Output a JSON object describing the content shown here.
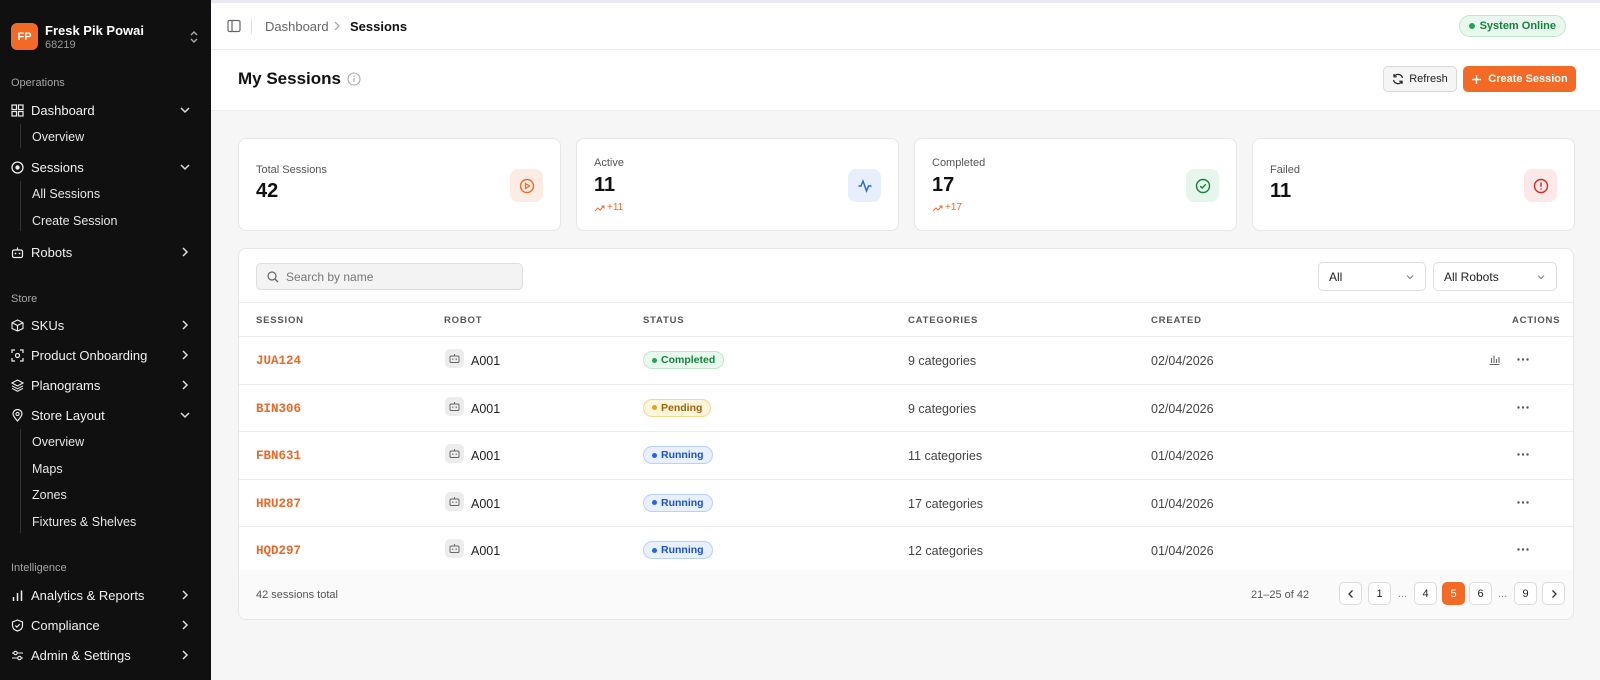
{
  "brand": {
    "initials": "FP",
    "name": "Fresk Pik Powai",
    "id": "68219"
  },
  "sidebar": {
    "sections": [
      "Operations",
      "Store",
      "Intelligence"
    ],
    "items": {
      "dashboard": "Dashboard",
      "overview": "Overview",
      "sessions": "Sessions",
      "all_sessions": "All Sessions",
      "create_session": "Create Session",
      "robots": "Robots",
      "skus": "SKUs",
      "product_onboarding": "Product Onboarding",
      "planograms": "Planograms",
      "store_layout": "Store Layout",
      "layout_overview": "Overview",
      "maps": "Maps",
      "zones": "Zones",
      "fixtures": "Fixtures & Shelves",
      "analytics": "Analytics & Reports",
      "compliance": "Compliance",
      "admin": "Admin & Settings"
    }
  },
  "header": {
    "breadcrumb": [
      "Dashboard",
      "Sessions"
    ],
    "status": "System Online",
    "title": "My Sessions",
    "refresh_label": "Refresh",
    "create_label": "Create Session"
  },
  "stats": [
    {
      "label": "Total Sessions",
      "value": "42",
      "trend": ""
    },
    {
      "label": "Active",
      "value": "11",
      "trend": "+11"
    },
    {
      "label": "Completed",
      "value": "17",
      "trend": "+17"
    },
    {
      "label": "Failed",
      "value": "11",
      "trend": ""
    }
  ],
  "filters": {
    "search_placeholder": "Search by name",
    "status_value": "All",
    "robot_value": "All Robots"
  },
  "table": {
    "columns": [
      "SESSION",
      "ROBOT",
      "STATUS",
      "CATEGORIES",
      "CREATED",
      "ACTIONS"
    ],
    "rows": [
      {
        "session": "JUA124",
        "robot": "A001",
        "status": "Completed",
        "categories": "9 categories",
        "created": "02/04/2026"
      },
      {
        "session": "BIN306",
        "robot": "A001",
        "status": "Pending",
        "categories": "9 categories",
        "created": "02/04/2026"
      },
      {
        "session": "FBN631",
        "robot": "A001",
        "status": "Running",
        "categories": "11 categories",
        "created": "01/04/2026"
      },
      {
        "session": "HRU287",
        "robot": "A001",
        "status": "Running",
        "categories": "17 categories",
        "created": "01/04/2026"
      },
      {
        "session": "HQD297",
        "robot": "A001",
        "status": "Running",
        "categories": "12 categories",
        "created": "01/04/2026"
      }
    ]
  },
  "footer": {
    "total": "42 sessions total",
    "range": "21–25 of 42",
    "pages": [
      "1",
      "...",
      "4",
      "5",
      "6",
      "...",
      "9"
    ],
    "current_page": "5"
  },
  "colors": {
    "accent": "#f26a25",
    "completed": "#16803f",
    "pending": "#b7791f",
    "running": "#2563eb"
  }
}
